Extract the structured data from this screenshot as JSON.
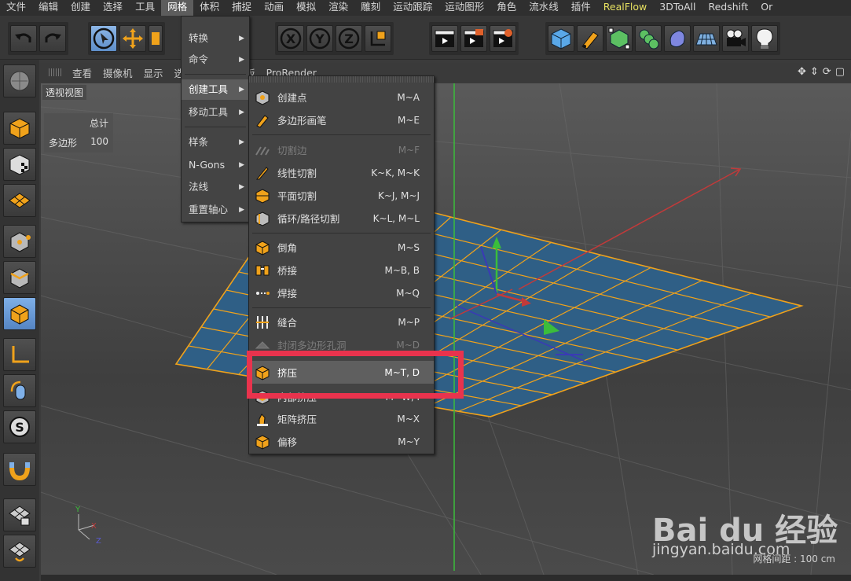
{
  "menubar": {
    "items": [
      "文件",
      "编辑",
      "创建",
      "选择",
      "工具",
      "网格",
      "体积",
      "捕捉",
      "动画",
      "模拟",
      "渲染",
      "雕刻",
      "运动跟踪",
      "运动图形",
      "角色",
      "流水线",
      "插件",
      "RealFlow",
      "3DToAll",
      "Redshift",
      "Or"
    ],
    "active": "网格"
  },
  "viewport_menu": [
    "查看",
    "摄像机",
    "显示",
    "选项",
    "过滤",
    "面板",
    "ProRender"
  ],
  "viewport": {
    "label": "透视视图",
    "hud_header": "总计",
    "hud_row_label": "多边形",
    "hud_row_value": "100",
    "grid_info": "网格间距 : 100 cm"
  },
  "mesh_menu": {
    "items": [
      {
        "label": "转换",
        "submenu": true
      },
      {
        "label": "命令",
        "submenu": true
      },
      {
        "label": "创建工具",
        "submenu": true,
        "highlight": true
      },
      {
        "label": "移动工具",
        "submenu": true
      },
      {
        "label": "样条",
        "submenu": true
      },
      {
        "label": "N-Gons",
        "submenu": true
      },
      {
        "label": "法线",
        "submenu": true
      },
      {
        "label": "重置轴心",
        "submenu": true
      }
    ],
    "arrow": "▶"
  },
  "create_tools_submenu": {
    "items": [
      {
        "label": "创建点",
        "shortcut": "M~A",
        "icon": "create-point-icon"
      },
      {
        "label": "多边形画笔",
        "shortcut": "M~E",
        "icon": "polygon-pen-icon"
      },
      {
        "label": "切割边",
        "shortcut": "M~F",
        "icon": "edge-cut-icon",
        "disabled": true
      },
      {
        "label": "线性切割",
        "shortcut": "K~K, M~K",
        "icon": "knife-icon"
      },
      {
        "label": "平面切割",
        "shortcut": "K~J, M~J",
        "icon": "plane-cut-icon"
      },
      {
        "label": "循环/路径切割",
        "shortcut": "K~L, M~L",
        "icon": "loop-cut-icon"
      },
      {
        "label": "倒角",
        "shortcut": "M~S",
        "icon": "bevel-icon"
      },
      {
        "label": "桥接",
        "shortcut": "M~B, B",
        "icon": "bridge-icon"
      },
      {
        "label": "焊接",
        "shortcut": "M~Q",
        "icon": "weld-icon"
      },
      {
        "label": "缝合",
        "shortcut": "M~P",
        "icon": "stitch-icon"
      },
      {
        "label": "封闭多边形孔洞",
        "shortcut": "M~D",
        "icon": "close-hole-icon",
        "disabled": true
      },
      {
        "label": "挤压",
        "shortcut": "M~T, D",
        "icon": "extrude-icon",
        "highlight": true
      },
      {
        "label": "内部挤压",
        "shortcut": "M~W, I",
        "icon": "extrude-inner-icon"
      },
      {
        "label": "矩阵挤压",
        "shortcut": "M~X",
        "icon": "matrix-extrude-icon"
      },
      {
        "label": "偏移",
        "shortcut": "M~Y",
        "icon": "offset-icon"
      }
    ]
  },
  "watermark": {
    "brand": "Bai du 经验",
    "url": "jingyan.baidu.com"
  },
  "colors": {
    "accent_orange": "#f0a21b",
    "highlight_box": "#e9334d",
    "selected_tool": "#6f9fd8",
    "plane_fill": "#2f5f86"
  },
  "toolbar_icons": [
    "undo-icon",
    "redo-icon",
    "select-icon",
    "move-icon",
    "scale-icon",
    "x-axis-icon",
    "y-axis-icon",
    "z-axis-icon",
    "coord-icon",
    "render-view-icon",
    "render-icon",
    "render-settings-icon",
    "cube-icon",
    "pen-icon",
    "subdivision-icon",
    "array-icon",
    "deformer-icon",
    "floor-icon",
    "camera-icon",
    "light-icon"
  ],
  "left_tool_icons": [
    "make-editable-icon",
    "model-mode-icon",
    "texture-mode-icon",
    "workplane-icon",
    "points-mode-icon",
    "edges-mode-icon",
    "polygons-mode-icon",
    "axis-mode-icon",
    "tweak-mode-icon",
    "solo-icon",
    "snap-icon",
    "lock-grid-icon",
    "workplane-lock-icon"
  ]
}
